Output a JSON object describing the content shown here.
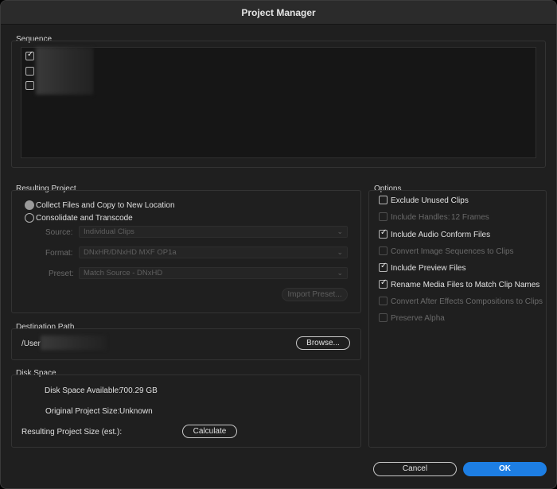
{
  "window": {
    "title": "Project Manager"
  },
  "sequence": {
    "label": "Sequence",
    "items": [
      {
        "checked": true
      },
      {
        "checked": false
      },
      {
        "checked": false
      }
    ]
  },
  "resulting_project": {
    "label": "Resulting Project",
    "options": [
      {
        "label": "Collect Files and Copy to New Location",
        "selected": true
      },
      {
        "label": "Consolidate and Transcode",
        "selected": false
      }
    ],
    "source": {
      "label": "Source:",
      "value": "Individual Clips"
    },
    "format": {
      "label": "Format:",
      "value": "DNxHR/DNxHD MXF OP1a"
    },
    "preset": {
      "label": "Preset:",
      "value": "Match Source - DNxHD"
    },
    "import_preset_label": "Import Preset..."
  },
  "destination": {
    "label": "Destination Path",
    "path": "/User",
    "browse_label": "Browse..."
  },
  "disk_space": {
    "label": "Disk Space",
    "available_label": "Disk Space Available:",
    "available_value": "700.29 GB",
    "original_label": "Original Project Size:",
    "original_value": "Unknown",
    "resulting_label": "Resulting Project Size (est.):",
    "calculate_label": "Calculate"
  },
  "options": {
    "label": "Options",
    "items": [
      {
        "label": "Exclude Unused Clips",
        "checked": false,
        "enabled": true
      },
      {
        "label": "Include Handles:",
        "checked": false,
        "enabled": false,
        "value": "12 Frames"
      },
      {
        "label": "Include Audio Conform Files",
        "checked": true,
        "enabled": true
      },
      {
        "label": "Convert Image Sequences to Clips",
        "checked": false,
        "enabled": false
      },
      {
        "label": "Include Preview Files",
        "checked": true,
        "enabled": true
      },
      {
        "label": "Rename Media Files to Match Clip Names",
        "checked": true,
        "enabled": true
      },
      {
        "label": "Convert After Effects Compositions to Clips",
        "checked": false,
        "enabled": false
      },
      {
        "label": "Preserve Alpha",
        "checked": false,
        "enabled": false
      }
    ]
  },
  "footer": {
    "cancel_label": "Cancel",
    "ok_label": "OK"
  },
  "colors": {
    "accent": "#1d7ee3",
    "background": "#1f1f1f",
    "panel": "#161616"
  }
}
